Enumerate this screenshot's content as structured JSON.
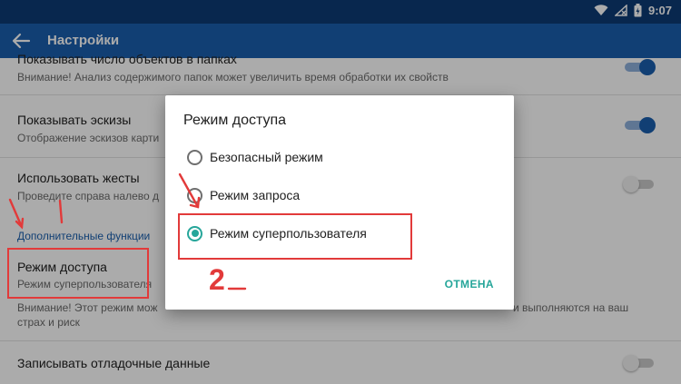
{
  "status_bar": {
    "time": "9:07",
    "icons": [
      "wifi-icon",
      "signal-off-icon",
      "battery-charging-icon"
    ]
  },
  "app_bar": {
    "title": "Настройки",
    "back_icon": "arrow-back-icon"
  },
  "settings": {
    "item_counts": {
      "title": "Показывать число объектов в папках",
      "subtitle": "Внимание! Анализ содержимого папок может увеличить время обработки их свойств",
      "switch_on": true
    },
    "thumbnails": {
      "title": "Показывать эскизы",
      "subtitle": "Отображение эскизов карти",
      "switch_on": true
    },
    "gestures": {
      "title": "Использовать жесты",
      "subtitle": "Проведите справа налево д",
      "switch_on": false
    },
    "section_header": "Дополнительные функции",
    "access_mode": {
      "title": "Режим доступа",
      "subtitle": "Режим суперпользователя"
    },
    "warning_text_line1": "Внимание! Этот режим мож",
    "warning_text_right": "и выполняются на ваш",
    "warning_text_line2": "страх и риск",
    "debug_log": {
      "title": "Записывать отладочные данные",
      "switch_on": false
    }
  },
  "dialog": {
    "title": "Режим доступа",
    "options": [
      {
        "label": "Безопасный режим",
        "selected": false
      },
      {
        "label": "Режим запроса",
        "selected": false
      },
      {
        "label": "Режим суперпользователя",
        "selected": true
      }
    ],
    "cancel_label": "ОТМЕНА"
  },
  "annotation": {
    "step_number": "2"
  },
  "colors": {
    "app_bar": "#1a5fae",
    "status_bar": "#0d3b75",
    "accent": "#26a69a",
    "annotation_red": "#e23a3a"
  }
}
